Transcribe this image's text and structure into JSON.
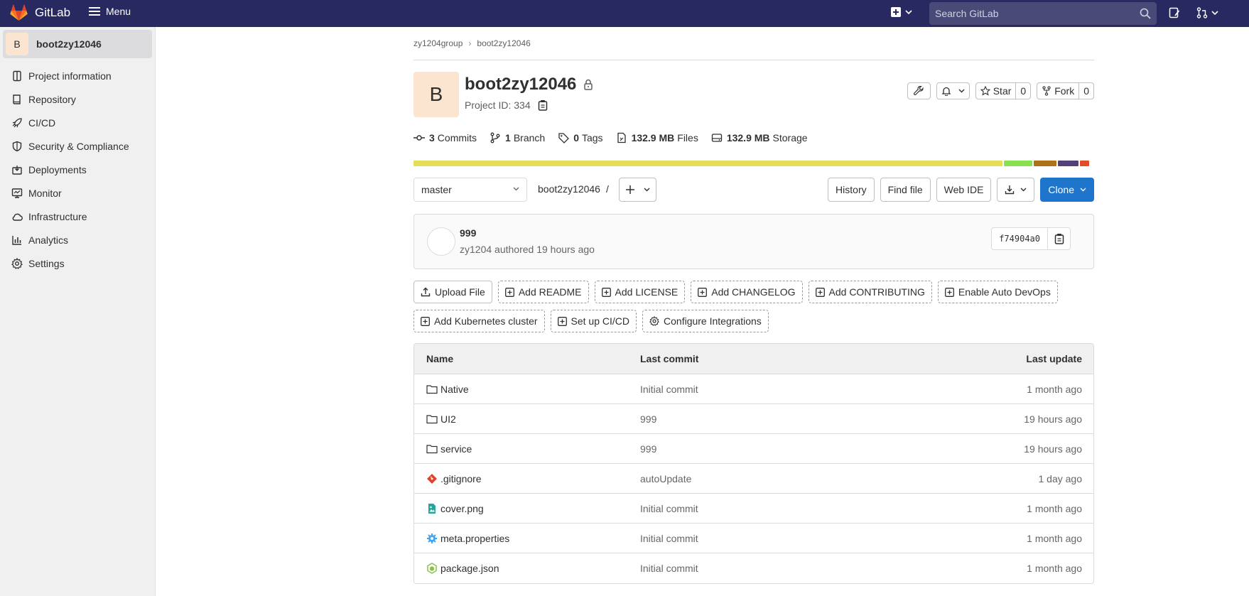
{
  "navbar": {
    "brand": "GitLab",
    "menu_label": "Menu",
    "search_placeholder": "Search GitLab",
    "bg_color": "#292961"
  },
  "sidebar": {
    "project_initial": "B",
    "project_name": "boot2zy12046",
    "items": [
      {
        "label": "Project information",
        "icon": "info-icon"
      },
      {
        "label": "Repository",
        "icon": "book-icon"
      },
      {
        "label": "CI/CD",
        "icon": "rocket-icon"
      },
      {
        "label": "Security & Compliance",
        "icon": "shield-icon"
      },
      {
        "label": "Deployments",
        "icon": "deployments-icon"
      },
      {
        "label": "Monitor",
        "icon": "monitor-icon"
      },
      {
        "label": "Infrastructure",
        "icon": "cloud-icon"
      },
      {
        "label": "Analytics",
        "icon": "chart-icon"
      },
      {
        "label": "Settings",
        "icon": "gear-icon"
      }
    ]
  },
  "breadcrumb": [
    "zy1204group",
    "boot2zy12046"
  ],
  "project": {
    "initial": "B",
    "title": "boot2zy12046",
    "id_text": "Project ID: 334",
    "star_label": "Star",
    "star_count": "0",
    "fork_label": "Fork",
    "fork_count": "0"
  },
  "stats": {
    "commits_num": "3",
    "commits_label": "Commits",
    "branch_num": "1",
    "branch_label": "Branch",
    "tags_num": "0",
    "tags_label": "Tags",
    "files_num": "132.9 MB",
    "files_label": "Files",
    "storage_num": "132.9 MB",
    "storage_label": "Storage"
  },
  "language_bar": [
    {
      "color": "#e4de5b",
      "share": 0.873
    },
    {
      "color": "#89e051",
      "share": 0.042
    },
    {
      "color": "#b07219",
      "share": 0.034
    },
    {
      "color": "#563d7c",
      "share": 0.03
    },
    {
      "color": "#e34c26",
      "share": 0.014
    }
  ],
  "toolbar": {
    "branch": "master",
    "path": "boot2zy12046",
    "path_sep": "/",
    "history": "History",
    "find_file": "Find file",
    "web_ide": "Web IDE",
    "clone": "Clone",
    "accent": "#1f75cb"
  },
  "last_commit": {
    "title": "999",
    "meta": "zy1204 authored 19 hours ago",
    "sha": "f74904a0"
  },
  "quick_actions": {
    "row1": [
      "Upload File",
      "Add README",
      "Add LICENSE",
      "Add CHANGELOG",
      "Add CONTRIBUTING",
      "Enable Auto DevOps"
    ],
    "row2": [
      "Add Kubernetes cluster",
      "Set up CI/CD",
      "Configure Integrations"
    ]
  },
  "tree": {
    "headers": {
      "name": "Name",
      "last_commit": "Last commit",
      "last_update": "Last update"
    },
    "rows": [
      {
        "name": "Native",
        "commit": "Initial commit",
        "updated": "1 month ago",
        "icon": "folder-icon"
      },
      {
        "name": "UI2",
        "commit": "999",
        "updated": "19 hours ago",
        "icon": "folder-icon"
      },
      {
        "name": "service",
        "commit": "999",
        "updated": "19 hours ago",
        "icon": "folder-icon"
      },
      {
        "name": ".gitignore",
        "commit": "autoUpdate",
        "updated": "1 day ago",
        "icon": "git-icon"
      },
      {
        "name": "cover.png",
        "commit": "Initial commit",
        "updated": "1 month ago",
        "icon": "image-file-icon"
      },
      {
        "name": "meta.properties",
        "commit": "Initial commit",
        "updated": "1 month ago",
        "icon": "settings-file-icon"
      },
      {
        "name": "package.json",
        "commit": "Initial commit",
        "updated": "1 month ago",
        "icon": "nodejs-icon"
      }
    ]
  }
}
